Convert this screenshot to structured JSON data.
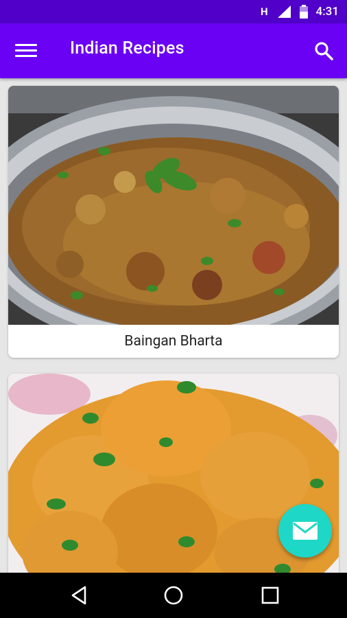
{
  "status_bar": {
    "network_label": "H",
    "time": "4:31",
    "icons": [
      "signal-icon",
      "battery-icon"
    ]
  },
  "app_bar": {
    "title": "Indian Recipes",
    "icons": [
      "menu-icon",
      "search-icon"
    ],
    "color": "#6a00f4"
  },
  "recipes": [
    {
      "name": "Baingan Bharta",
      "image": "baingan-bharta-photo"
    },
    {
      "name": "",
      "image": "chicken-curry-photo"
    }
  ],
  "fab": {
    "icon": "mail-icon",
    "color": "#1ed7c6"
  },
  "nav_bar": {
    "icons": [
      "back-icon",
      "home-icon",
      "recents-icon"
    ]
  }
}
